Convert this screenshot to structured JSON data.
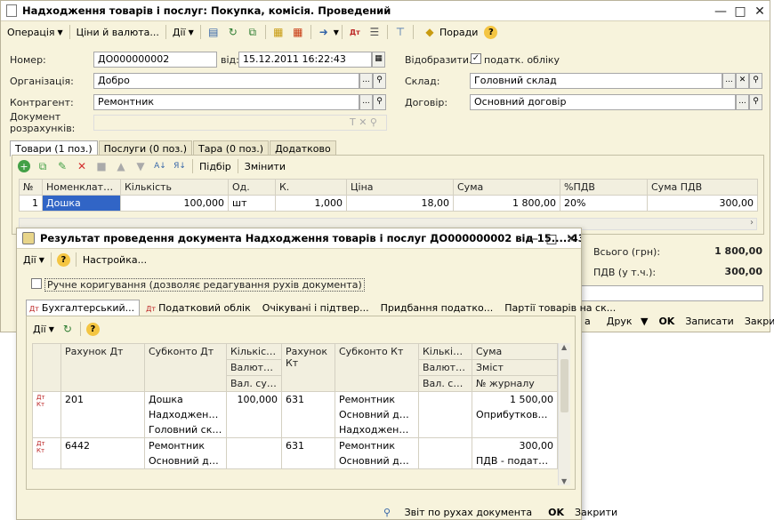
{
  "main": {
    "title": "Надходження товарів і послуг: Покупка, комісія. Проведений",
    "toolbar": {
      "operation": "Операція",
      "prices": "Ціни й валюта...",
      "actions": "Дії",
      "tips": "Поради"
    },
    "fields": {
      "number_label": "Номер:",
      "number_value": "ДО000000002",
      "date_label": "від:",
      "date_value": "15.12.2011 16:22:43",
      "org_label": "Організація:",
      "org_value": "Добро",
      "counterparty_label": "Контрагент:",
      "counterparty_value": "Ремонтник",
      "doc_label": "Документ розрахунків:",
      "reflect_label": "Відобразити...",
      "tax_label": "податк. обліку",
      "warehouse_label": "Склад:",
      "warehouse_value": "Головний склад",
      "contract_label": "Договір:",
      "contract_value": "Основний договір"
    },
    "tabs": [
      "Товари (1 поз.)",
      "Послуги (0 поз.)",
      "Тара (0 поз.)",
      "Додатково"
    ],
    "table_toolbar": {
      "select": "Підбір",
      "change": "Змінити"
    },
    "table_headers": [
      "№",
      "Номенклатура",
      "Кількість",
      "Од.",
      "К.",
      "Ціна",
      "Сума",
      "%ПДВ",
      "Сума ПДВ"
    ],
    "table_rows": [
      [
        "1",
        "Дошка",
        "100,000",
        "шт",
        "1,000",
        "18,00",
        "1 800,00",
        "20%",
        "300,00"
      ]
    ],
    "totals": {
      "total_label": "Всього (грн):",
      "total_value": "1 800,00",
      "vat_label": "ПДВ (у т.ч.):",
      "vat_value": "300,00"
    },
    "bottom": {
      "print": "Друк",
      "ok": "OK",
      "save": "Записати",
      "close": "Закрити",
      "partial": "а"
    }
  },
  "dialog": {
    "title": "Результат проведення документа Надходження товарів і послуг ДО000000002 від 15....:43",
    "toolbar": {
      "actions": "Дії",
      "settings": "Настройка..."
    },
    "manual": "Ручне коригування (дозволяє редагування рухів документа)",
    "tabs": [
      "Бухгалтерський...",
      "Податковий облік",
      "Очікувані і підтвер...",
      "Придбання податко...",
      "Партії товарів на ск..."
    ],
    "inner_toolbar": {
      "actions": "Дії"
    },
    "headers": {
      "debit_account": "Рахунок Дт",
      "debit_subconto": "Субконто Дт",
      "qty1": "Кількіст...",
      "currency1": "Валюта ...",
      "curr_sum1": "Вал. сум...",
      "credit_account": "Рахунок Кт",
      "credit_subconto": "Субконто Кт",
      "qty2": "Кількіст...",
      "currency2": "Валюта Кт",
      "curr_sum2": "Вал. сум...",
      "sum": "Сума",
      "content": "Зміст",
      "journal": "№ журналу"
    },
    "rows": [
      {
        "dt": "201",
        "sub_dt": [
          "Дошка",
          "Надходження ...",
          "Головний склад"
        ],
        "qty": "100,000",
        "kt": "631",
        "sub_kt": [
          "Ремонтник",
          "Основний дог...",
          "Надходження ..."
        ],
        "sum": "1 500,00",
        "content": "Оприбутковані..."
      },
      {
        "dt": "6442",
        "sub_dt": [
          "Ремонтник",
          "Основний дог..."
        ],
        "qty": "",
        "kt": "631",
        "sub_kt": [
          "Ремонтник",
          "Основний дог..."
        ],
        "sum": "300,00",
        "content": "ПДВ - податко..."
      }
    ],
    "bottom": {
      "report": "Звіт по рухах документа",
      "ok": "OK",
      "close": "Закрити"
    }
  }
}
